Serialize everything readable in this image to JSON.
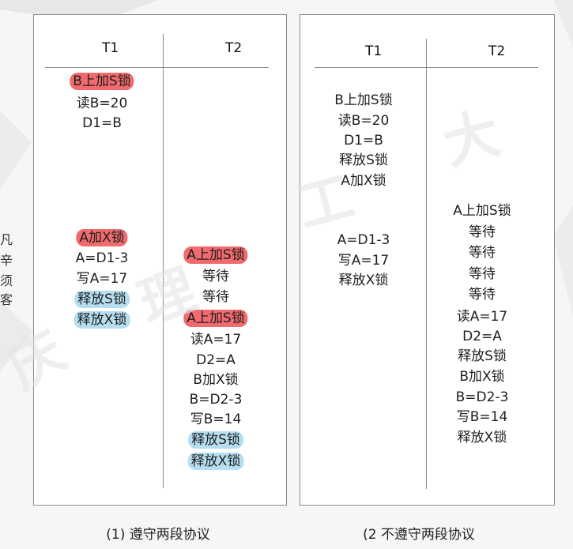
{
  "left_panel": {
    "headers": {
      "t1": "T1",
      "t2": "T2"
    },
    "t1_steps": [
      {
        "text": "B上加S锁",
        "hl": "red"
      },
      {
        "text": "读B=20",
        "hl": ""
      },
      {
        "text": "D1=B",
        "hl": ""
      },
      {
        "text": "A加X锁",
        "hl": "red"
      },
      {
        "text": "A=D1-3",
        "hl": ""
      },
      {
        "text": "写A=17",
        "hl": ""
      },
      {
        "text": "释放S锁",
        "hl": "blue"
      },
      {
        "text": "释放X锁",
        "hl": "blue"
      }
    ],
    "t2_steps": [
      {
        "text": "A上加S锁",
        "hl": "red"
      },
      {
        "text": "等待",
        "hl": ""
      },
      {
        "text": "等待",
        "hl": ""
      },
      {
        "text": "A上加S锁",
        "hl": "red"
      },
      {
        "text": "读A=17",
        "hl": ""
      },
      {
        "text": "D2=A",
        "hl": ""
      },
      {
        "text": "B加X锁",
        "hl": ""
      },
      {
        "text": "B=D2-3",
        "hl": ""
      },
      {
        "text": "写B=14",
        "hl": ""
      },
      {
        "text": "释放S锁",
        "hl": "blue"
      },
      {
        "text": "释放X锁",
        "hl": "blue"
      }
    ],
    "caption": "(1) 遵守两段协议"
  },
  "right_panel": {
    "headers": {
      "t1": "T1",
      "t2": "T2"
    },
    "t1_steps": [
      {
        "text": "B上加S锁"
      },
      {
        "text": "读B=20"
      },
      {
        "text": "D1=B"
      },
      {
        "text": "释放S锁"
      },
      {
        "text": "A加X锁"
      },
      {
        "text": "A=D1-3"
      },
      {
        "text": "写A=17"
      },
      {
        "text": "释放X锁"
      }
    ],
    "t2_steps": [
      {
        "text": "A上加S锁"
      },
      {
        "text": "等待"
      },
      {
        "text": "等待"
      },
      {
        "text": "等待"
      },
      {
        "text": "等待"
      },
      {
        "text": "读A=17"
      },
      {
        "text": "D2=A"
      },
      {
        "text": "释放S锁"
      },
      {
        "text": "B加X锁"
      },
      {
        "text": "B=D2-3"
      },
      {
        "text": "写B=14"
      },
      {
        "text": "释放X锁"
      }
    ],
    "caption": "(2 不遵守两段协议"
  },
  "watermark": {
    "chars": [
      "庆",
      "理",
      "工",
      "大"
    ]
  },
  "colors": {
    "highlight_red": "#f06a6e",
    "highlight_blue": "#b5dff0",
    "border": "#8a8a8a"
  }
}
